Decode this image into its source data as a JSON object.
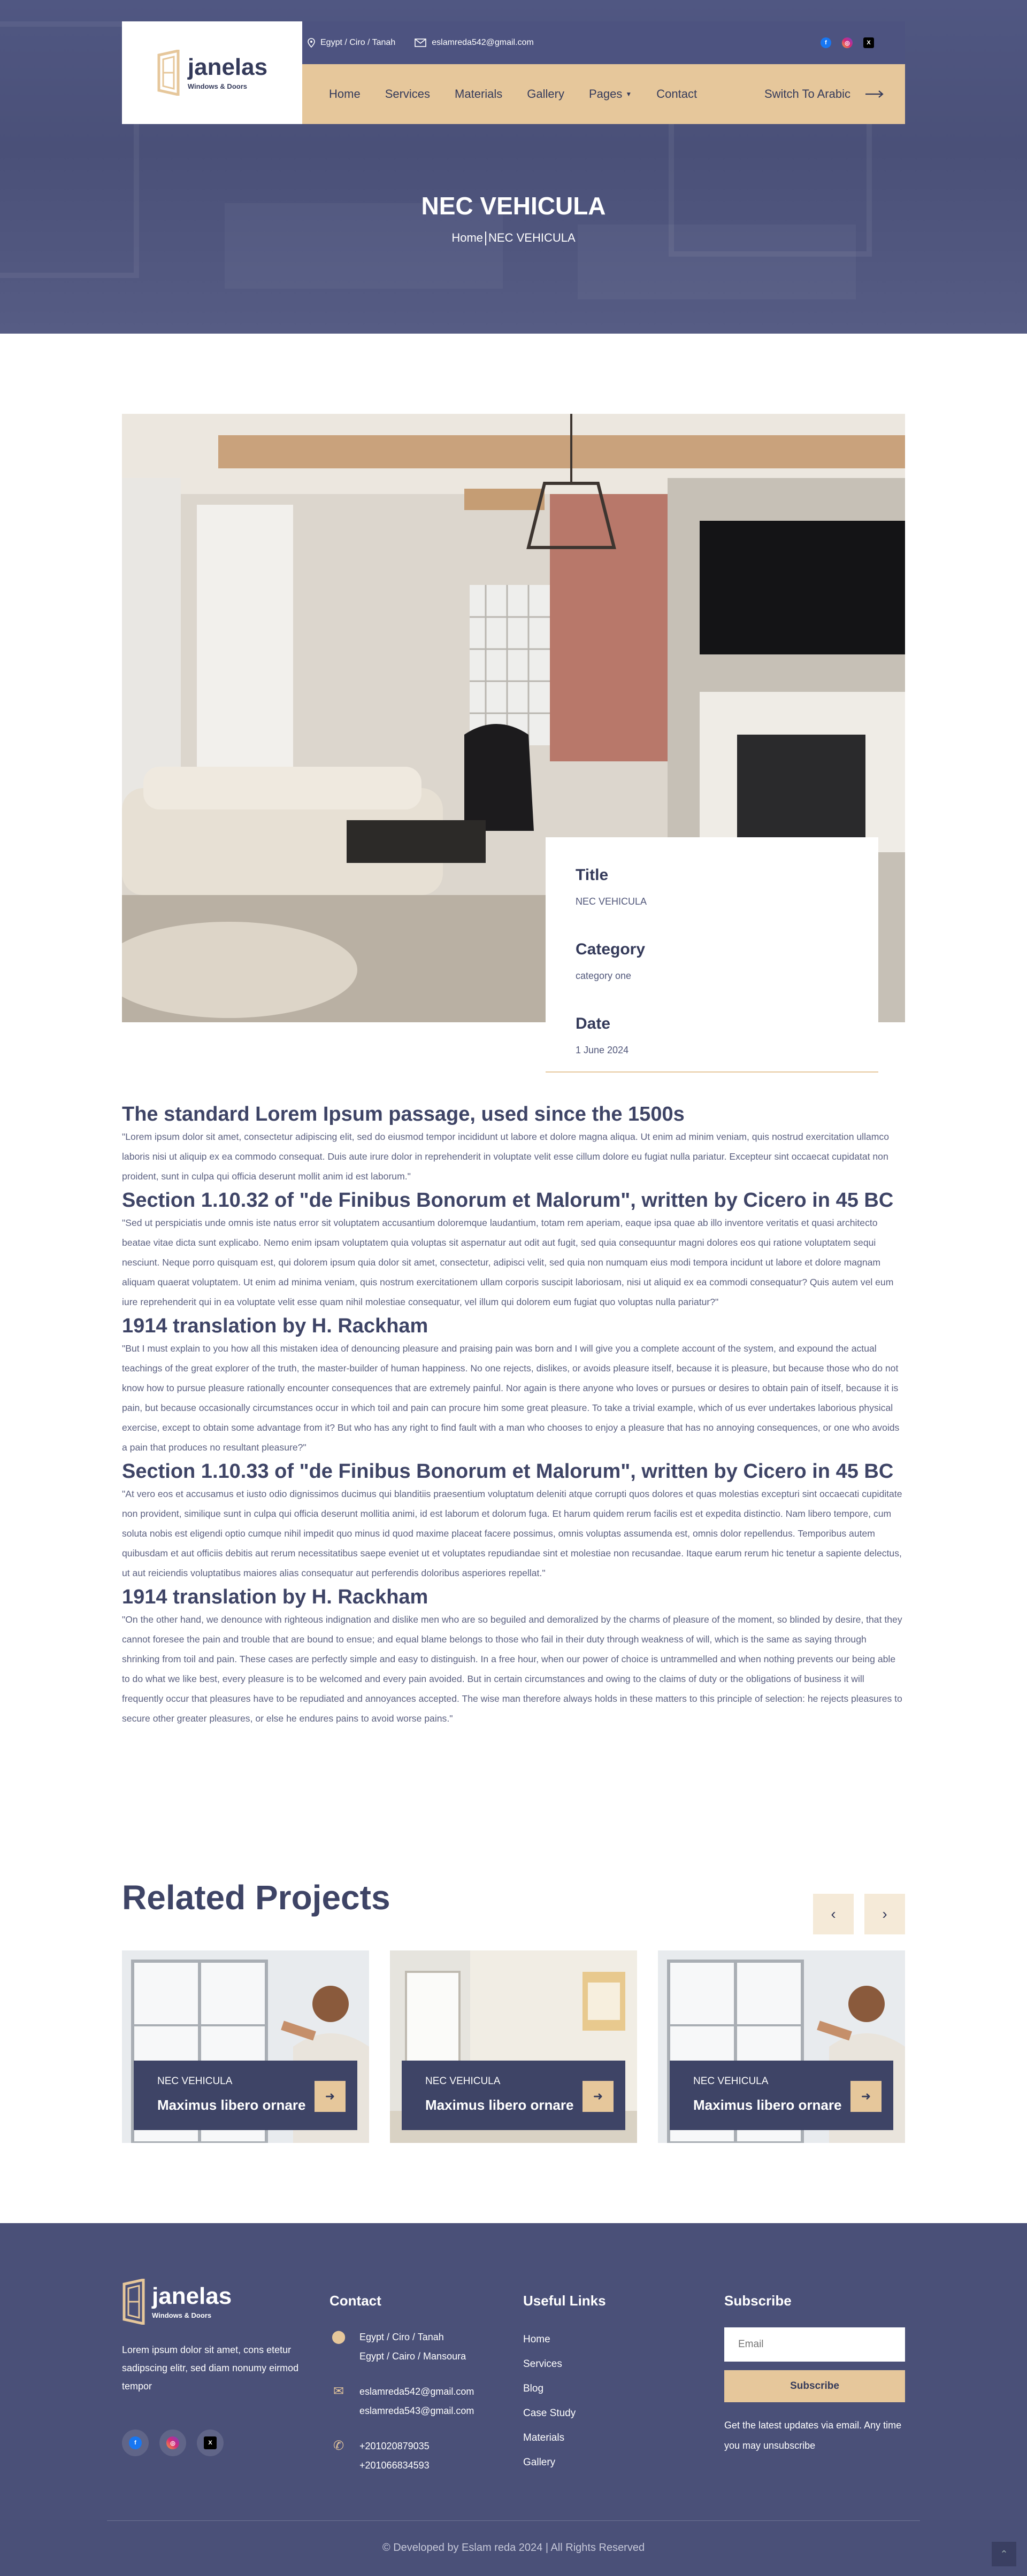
{
  "header": {
    "logo": {
      "name": "janelas",
      "tagline": "Windows & Doors"
    },
    "location": "Egypt / Ciro / Tanah",
    "email": "eslamreda542@gmail.com",
    "socials": [
      "facebook-icon",
      "instagram-icon",
      "x-icon"
    ],
    "nav": [
      "Home",
      "Services",
      "Materials",
      "Gallery",
      "Pages",
      "Contact"
    ],
    "switch_label": "Switch To Arabic"
  },
  "hero": {
    "title": "NEC VEHICULA",
    "crumb_home": "Home",
    "crumb_current": "NEC VEHICULA"
  },
  "info": {
    "title_label": "Title",
    "title_value": "NEC VEHICULA",
    "category_label": "Category",
    "category_value": "category one",
    "date_label": "Date",
    "date_value": "1 June 2024"
  },
  "article": [
    {
      "heading": "The standard Lorem Ipsum passage, used since the 1500s",
      "body": "\"Lorem ipsum dolor sit amet, consectetur adipiscing elit, sed do eiusmod tempor incididunt ut labore et dolore magna aliqua. Ut enim ad minim veniam, quis nostrud exercitation ullamco laboris nisi ut aliquip ex ea commodo consequat. Duis aute irure dolor in reprehenderit in voluptate velit esse cillum dolore eu fugiat nulla pariatur. Excepteur sint occaecat cupidatat non proident, sunt in culpa qui officia deserunt mollit anim id est laborum.\""
    },
    {
      "heading": "Section 1.10.32 of \"de Finibus Bonorum et Malorum\", written by Cicero in 45 BC",
      "body": "\"Sed ut perspiciatis unde omnis iste natus error sit voluptatem accusantium doloremque laudantium, totam rem aperiam, eaque ipsa quae ab illo inventore veritatis et quasi architecto beatae vitae dicta sunt explicabo. Nemo enim ipsam voluptatem quia voluptas sit aspernatur aut odit aut fugit, sed quia consequuntur magni dolores eos qui ratione voluptatem sequi nesciunt. Neque porro quisquam est, qui dolorem ipsum quia dolor sit amet, consectetur, adipisci velit, sed quia non numquam eius modi tempora incidunt ut labore et dolore magnam aliquam quaerat voluptatem. Ut enim ad minima veniam, quis nostrum exercitationem ullam corporis suscipit laboriosam, nisi ut aliquid ex ea commodi consequatur? Quis autem vel eum iure reprehenderit qui in ea voluptate velit esse quam nihil molestiae consequatur, vel illum qui dolorem eum fugiat quo voluptas nulla pariatur?\""
    },
    {
      "heading": "1914 translation by H. Rackham",
      "body": "\"But I must explain to you how all this mistaken idea of denouncing pleasure and praising pain was born and I will give you a complete account of the system, and expound the actual teachings of the great explorer of the truth, the master-builder of human happiness. No one rejects, dislikes, or avoids pleasure itself, because it is pleasure, but because those who do not know how to pursue pleasure rationally encounter consequences that are extremely painful. Nor again is there anyone who loves or pursues or desires to obtain pain of itself, because it is pain, but because occasionally circumstances occur in which toil and pain can procure him some great pleasure. To take a trivial example, which of us ever undertakes laborious physical exercise, except to obtain some advantage from it? But who has any right to find fault with a man who chooses to enjoy a pleasure that has no annoying consequences, or one who avoids a pain that produces no resultant pleasure?\""
    },
    {
      "heading": "Section 1.10.33 of \"de Finibus Bonorum et Malorum\", written by Cicero in 45 BC",
      "body": "\"At vero eos et accusamus et iusto odio dignissimos ducimus qui blanditiis praesentium voluptatum deleniti atque corrupti quos dolores et quas molestias excepturi sint occaecati cupiditate non provident, similique sunt in culpa qui officia deserunt mollitia animi, id est laborum et dolorum fuga. Et harum quidem rerum facilis est et expedita distinctio. Nam libero tempore, cum soluta nobis est eligendi optio cumque nihil impedit quo minus id quod maxime placeat facere possimus, omnis voluptas assumenda est, omnis dolor repellendus. Temporibus autem quibusdam et aut officiis debitis aut rerum necessitatibus saepe eveniet ut et voluptates repudiandae sint et molestiae non recusandae. Itaque earum rerum hic tenetur a sapiente delectus, ut aut reiciendis voluptatibus maiores alias consequatur aut perferendis doloribus asperiores repellat.\""
    },
    {
      "heading": "1914 translation by H. Rackham",
      "body": "\"On the other hand, we denounce with righteous indignation and dislike men who are so beguiled and demoralized by the charms of pleasure of the moment, so blinded by desire, that they cannot foresee the pain and trouble that are bound to ensue; and equal blame belongs to those who fail in their duty through weakness of will, which is the same as saying through shrinking from toil and pain. These cases are perfectly simple and easy to distinguish. In a free hour, when our power of choice is untrammelled and when nothing prevents our being able to do what we like best, every pleasure is to be welcomed and every pain avoided. But in certain circumstances and owing to the claims of duty or the obligations of business it will frequently occur that pleasures have to be repudiated and annoyances accepted. The wise man therefore always holds in these matters to this principle of selection: he rejects pleasures to secure other greater pleasures, or else he endures pains to avoid worse pains.\""
    }
  ],
  "related": {
    "title": "Related Projects",
    "prev_icon": "chevron-left-icon",
    "next_icon": "chevron-right-icon",
    "cards": [
      {
        "category": "NEC VEHICULA",
        "title": "Maximus libero ornare"
      },
      {
        "category": "NEC VEHICULA",
        "title": "Maximus libero ornare"
      },
      {
        "category": "NEC VEHICULA",
        "title": "Maximus libero ornare"
      }
    ]
  },
  "footer": {
    "logo": {
      "name": "janelas",
      "tagline": "Windows & Doors"
    },
    "about": "Lorem ipsum dolor sit amet, cons etetur sadipscing elitr, sed diam nonumy eirmod tempor",
    "contact_title": "Contact",
    "addr1": "Egypt / Ciro / Tanah",
    "addr2": "Egypt / Cairo / Mansoura",
    "email1": "eslamreda542@gmail.com",
    "email2": "eslamreda543@gmail.com",
    "phone1": "+201020879035",
    "phone2": "+201066834593",
    "links_title": "Useful Links",
    "links": [
      "Home",
      "Services",
      "Blog",
      "Case Study",
      "Materials",
      "Gallery"
    ],
    "subscribe_title": "Subscribe",
    "email_placeholder": "Email",
    "subscribe_btn": "Subscribe",
    "subscribe_note": "Get the latest updates via email. Any time you may unsubscribe",
    "copyright": "© Developed by Eslam reda  2024 | All Rights Reserved"
  },
  "colors": {
    "primary": "#4a5078",
    "accent": "#e6c79b",
    "text": "#3e4466"
  }
}
